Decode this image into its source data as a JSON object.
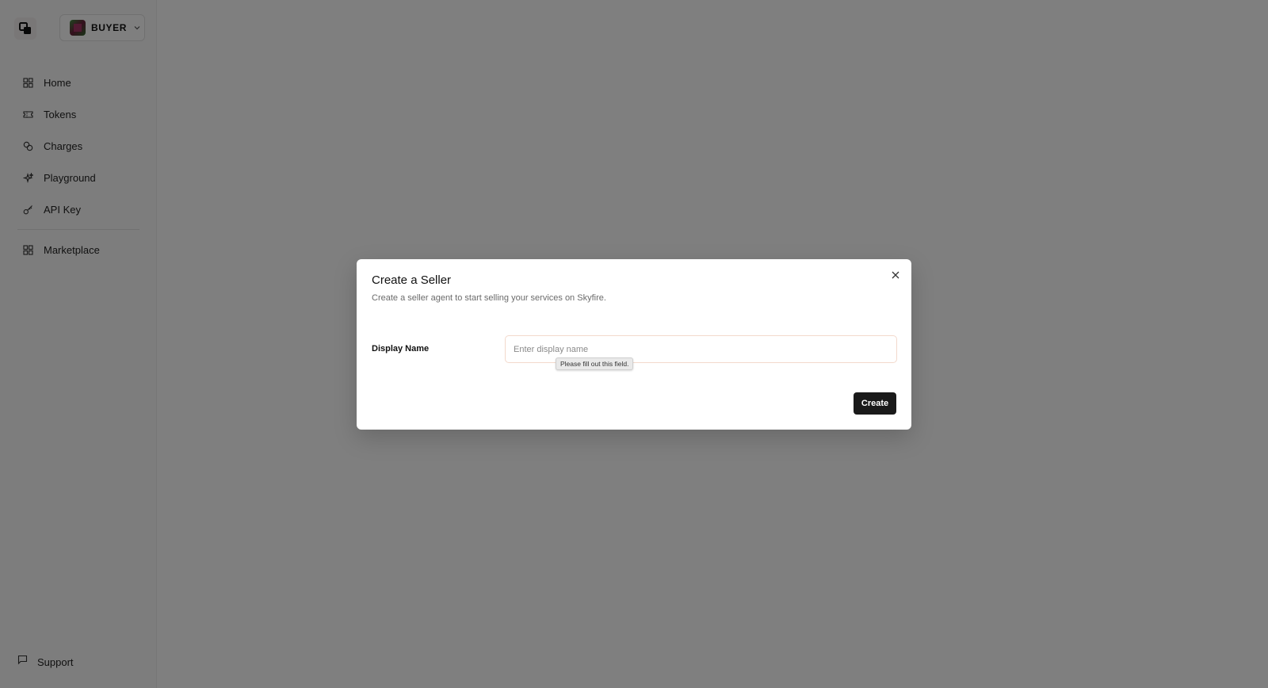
{
  "sidebar": {
    "account": {
      "label": "BUYER",
      "avatar_colors": [
        "#3c8a3c",
        "#a23564"
      ]
    },
    "items": [
      {
        "label": "Home",
        "icon": "grid-icon"
      },
      {
        "label": "Tokens",
        "icon": "ticket-icon"
      },
      {
        "label": "Charges",
        "icon": "coins-icon"
      },
      {
        "label": "Playground",
        "icon": "sparkles-icon"
      },
      {
        "label": "API Key",
        "icon": "key-icon"
      }
    ],
    "secondary_items": [
      {
        "label": "Marketplace",
        "icon": "grid-icon"
      }
    ],
    "support": {
      "label": "Support",
      "icon": "message-square-icon"
    }
  },
  "dialog": {
    "title": "Create a Seller",
    "description": "Create a seller agent to start selling your services on Skyfire.",
    "field_label": "Display Name",
    "field_placeholder": "Enter display name",
    "field_value": "",
    "validation_tooltip": "Please fill out this field.",
    "submit_label": "Create",
    "close_icon": "close-icon"
  },
  "colors": {
    "overlay": "rgba(0,0,0,0.5)",
    "primary_button": "#1a1a1a",
    "input_border_focus": "#f3d9cc"
  }
}
